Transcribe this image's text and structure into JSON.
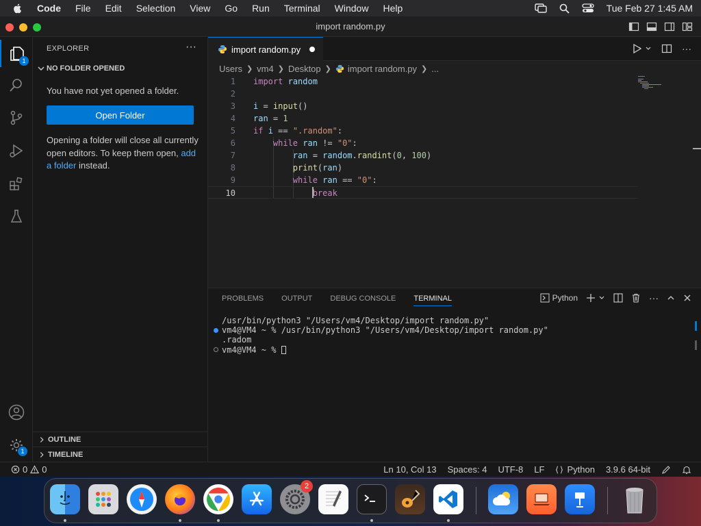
{
  "menubar": {
    "app": "Code",
    "items": [
      "File",
      "Edit",
      "Selection",
      "View",
      "Go",
      "Run",
      "Terminal",
      "Window",
      "Help"
    ],
    "clock": "Tue Feb 27  1:45 AM"
  },
  "window": {
    "title": "import random.py"
  },
  "activity": {
    "explorer_badge": "1",
    "settings_badge": "1"
  },
  "sidebar": {
    "header": "EXPLORER",
    "section": "NO FOLDER OPENED",
    "message": "You have not yet opened a folder.",
    "open_folder": "Open Folder",
    "info_before": "Opening a folder will close all currently open editors. To keep them open, ",
    "info_link": "add a folder",
    "info_after": " instead.",
    "outline": "OUTLINE",
    "timeline": "TIMELINE"
  },
  "tab": {
    "label": "import random.py"
  },
  "breadcrumb": [
    "Users",
    "vm4",
    "Desktop",
    "import random.py",
    "..."
  ],
  "editor": {
    "line_numbers": [
      "1",
      "2",
      "3",
      "4",
      "5",
      "6",
      "7",
      "8",
      "9",
      "10"
    ]
  },
  "panel": {
    "tabs": [
      "PROBLEMS",
      "OUTPUT",
      "DEBUG CONSOLE",
      "TERMINAL"
    ],
    "shell": "Python",
    "terminal_lines": [
      "/usr/bin/python3 \"/Users/vm4/Desktop/import random.py\"",
      "vm4@VM4 ~ % /usr/bin/python3 \"/Users/vm4/Desktop/import random.py\"",
      ".radom",
      "vm4@VM4 ~ % "
    ]
  },
  "status": {
    "errors": "0",
    "warnings": "0",
    "position": "Ln 10, Col 13",
    "spaces": "Spaces: 4",
    "encoding": "UTF-8",
    "eol": "LF",
    "language": "Python",
    "interpreter": "3.9.6 64-bit"
  },
  "dock": {
    "settings_badge": "2"
  },
  "colors": {
    "accent": "#0078d4",
    "background": "#1f1f1f",
    "sidebar": "#181818"
  }
}
